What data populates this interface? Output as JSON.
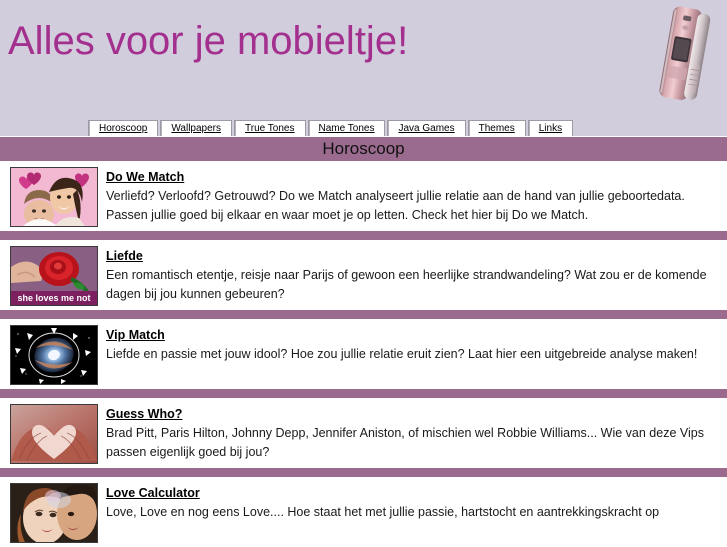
{
  "header": {
    "site_title": "Alles voor je mobieltje!",
    "title_color": "#a32f8e",
    "background_color": "#d2cddc",
    "phone_icon": "mobile-phone-image"
  },
  "nav": {
    "tabs": [
      {
        "label": "Horoscoop",
        "active": true
      },
      {
        "label": "Wallpapers",
        "active": false
      },
      {
        "label": "True Tones",
        "active": false
      },
      {
        "label": "Name Tones",
        "active": false
      },
      {
        "label": "Java Games",
        "active": false
      },
      {
        "label": "Themes",
        "active": false
      },
      {
        "label": "Links",
        "active": false
      }
    ]
  },
  "section": {
    "title": "Horoscoop",
    "bar_color": "#9a6b8e"
  },
  "items": [
    {
      "title": "Do We Match",
      "description": "Verliefd? Verloofd? Getrouwd? Do we Match analyseert jullie relatie aan de hand van jullie geboortedata. Passen jullie goed bij elkaar en waar moet je op letten. Check het hier bij Do we Match.",
      "thumb_name": "couple-hearts-thumbnail"
    },
    {
      "title": "Liefde",
      "description": "Een romantisch etentje, reisje naar Parijs of gewoon een heerlijke strandwandeling? Wat zou er de komende dagen bij jou kunnen gebeuren?",
      "thumb_name": "rose-she-loves-me-not-thumbnail",
      "thumb_caption": "she loves me not"
    },
    {
      "title": "Vip Match",
      "description": "Liefde en passie met jouw idool? Hoe zou jullie relatie eruit zien? Laat hier een uitgebreide analyse maken!",
      "thumb_name": "zodiac-galaxy-thumbnail"
    },
    {
      "title": "Guess Who?",
      "description": "Brad Pitt, Paris Hilton, Johnny Depp, Jennifer Aniston, of mischien wel Robbie Williams... Wie van deze Vips passen eigenlijk goed bij jou?",
      "thumb_name": "hands-heart-thumbnail"
    },
    {
      "title": "Love Calculator",
      "description": "Love, Love en nog eens Love.... Hoe staat het met jullie passie, hartstocht en aantrekkingskracht op",
      "thumb_name": "couple-kiss-thumbnail"
    }
  ]
}
